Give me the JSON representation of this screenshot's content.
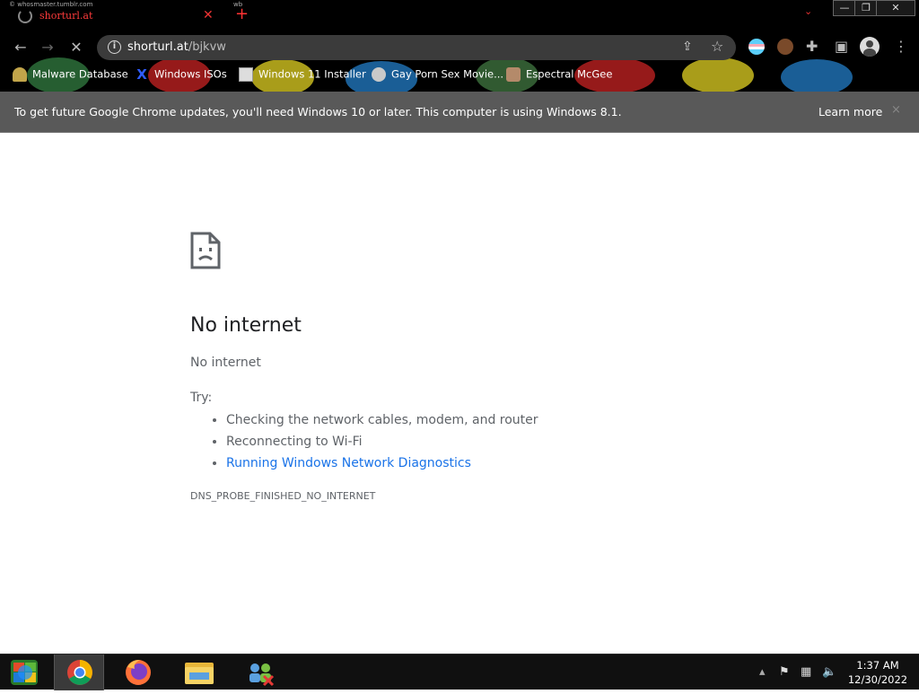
{
  "browser": {
    "tab": {
      "title": "shorturl.at",
      "tiny_note": "© whosmaster.tumblr.com",
      "tiny_note2": "wb"
    },
    "omnibox": {
      "host": "shorturl.at",
      "path": "/bjkvw"
    },
    "bookmarks": [
      {
        "label": "Malware Database",
        "icon": "pacman-ghost-icon",
        "color": "#c2a54a"
      },
      {
        "label": "Windows ISOs",
        "icon": "x-logo-icon",
        "color": "#2f5cff"
      },
      {
        "label": "Windows 11 Installer",
        "icon": "doc-image-icon",
        "color": "#dddddd"
      },
      {
        "label": "Gay Porn Sex Movie...",
        "icon": "avatar-icon",
        "color": "#c9c9c9"
      },
      {
        "label": "Espectral McGee",
        "icon": "character-icon",
        "color": "#b48a6a"
      }
    ]
  },
  "infobar": {
    "message": "To get future Google Chrome updates, you'll need Windows 10 or later. This computer is using Windows 8.1.",
    "learn_more": "Learn more",
    "close": "×"
  },
  "error_page": {
    "title": "No internet",
    "subtitle": "No internet",
    "try_label": "Try:",
    "suggestions": [
      {
        "text": "Checking the network cables, modem, and router",
        "link": false
      },
      {
        "text": "Reconnecting to Wi-Fi",
        "link": false
      },
      {
        "text": "Running Windows Network Diagnostics",
        "link": true
      }
    ],
    "error_code": "DNS_PROBE_FINISHED_NO_INTERNET"
  },
  "taskbar": {
    "apps": [
      "start-button",
      "chrome-app",
      "firefox-app",
      "file-explorer-app",
      "network-app"
    ],
    "clock_time": "1:37 AM",
    "clock_date": "12/30/2022"
  },
  "colors": {
    "link_blue": "#1a73e8",
    "infobar_bg": "#595959",
    "tab_red": "#ff3b3b"
  }
}
